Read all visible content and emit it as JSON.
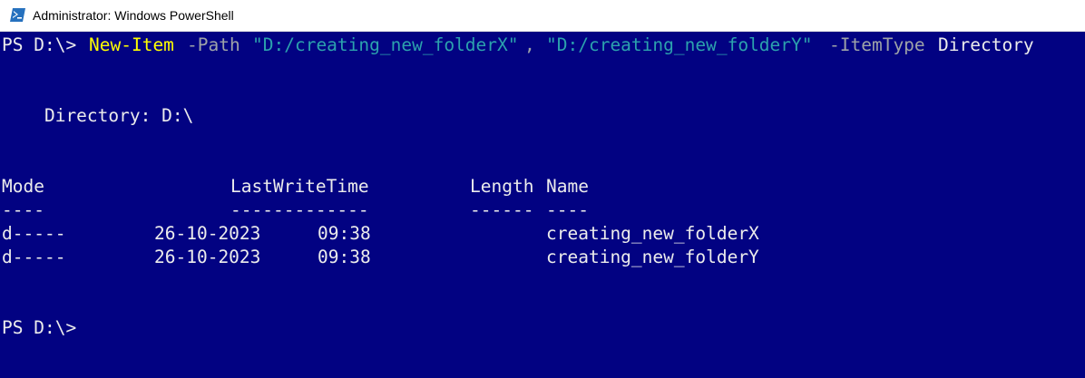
{
  "window": {
    "title": "Administrator: Windows PowerShell",
    "app_icon": "powershell-icon"
  },
  "colors": {
    "console_background": "#020282",
    "default_text": "#ececec",
    "cmdlet": "#ffff00",
    "parameter": "#9ea3a8",
    "string": "#2ca2ad"
  },
  "console": {
    "command": {
      "prompt": "PS D:\\>",
      "cmdlet": "New-Item",
      "path_param": "-Path",
      "path_value_1": "\"D:/creating_new_folderX\"",
      "separator": ",",
      "path_value_2": "\"D:/creating_new_folderY\"",
      "itemtype_param": "-ItemType",
      "itemtype_value": "Directory"
    },
    "directory_header": "    Directory: D:\\",
    "table": {
      "headers": {
        "mode": "Mode",
        "last_write_time": "LastWriteTime",
        "length": "Length",
        "name": "Name"
      },
      "underlines": {
        "mode": "----",
        "last_write_time": "-------------",
        "length": "------",
        "name": "----"
      },
      "rows": [
        {
          "mode": "d-----",
          "date": "26-10-2023",
          "time": "09:38",
          "length": "",
          "name": "creating_new_folderX"
        },
        {
          "mode": "d-----",
          "date": "26-10-2023",
          "time": "09:38",
          "length": "",
          "name": "creating_new_folderY"
        }
      ]
    },
    "final_prompt": "PS D:\\>"
  }
}
